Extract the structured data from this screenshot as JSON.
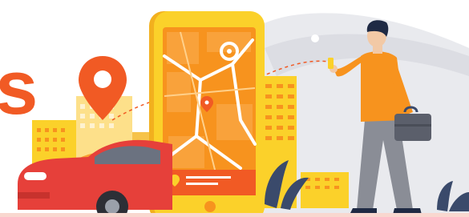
{
  "illustration": {
    "partial_heading_fragment": "s",
    "icons": {
      "map_pin": "map-pin-icon",
      "route_target": "route-target-icon",
      "briefcase": "briefcase-icon",
      "car": "car-icon",
      "smartphone": "smartphone-icon"
    }
  },
  "colors": {
    "orange": "#f15a24",
    "orange_light": "#f7931e",
    "yellow": "#fbd12a",
    "yellow_dark": "#f2b01e",
    "red_car": "#e6403a",
    "gray_bg": "#e6e7ec",
    "gray_dark": "#5b5f6b",
    "navy": "#1f2a44"
  }
}
